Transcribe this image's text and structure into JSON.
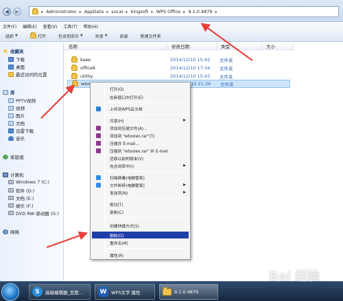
{
  "address": {
    "segments": [
      "Administrator",
      "AppData",
      "Local",
      "kingsoft",
      "WPS Office",
      "9.1.0.4879"
    ]
  },
  "menubar": [
    "文件(F)",
    "编辑(E)",
    "查看(V)",
    "工具(T)",
    "帮助(H)"
  ],
  "toolbar": {
    "organize": "组织",
    "open": "打开",
    "include": "包含到库中",
    "share": "共享",
    "burn": "刻录",
    "new_folder": "新建文件夹"
  },
  "nav": {
    "favorites_header": "收藏夹",
    "favorites": [
      "下载",
      "桌面",
      "最近访问的位置"
    ],
    "libraries_header": "库",
    "libraries": [
      "PPTV视频",
      "视频",
      "图片",
      "文档",
      "迅雷下载",
      "音乐"
    ],
    "homegroup": "家庭组",
    "computer_header": "计算机",
    "drives": [
      "Windows 7 (C:)",
      "软件 (D:)",
      "文档 (E:)",
      "娱乐 (F:)",
      "DVD RW 驱动器 (G:)"
    ],
    "network": "网络"
  },
  "columns": {
    "name": "名称",
    "modified": "修改日期",
    "type": "类型",
    "size": "大小"
  },
  "files": [
    {
      "name": "ksee",
      "date": "2014/12/10 15:42",
      "type": "文件夹"
    },
    {
      "name": "office6",
      "date": "2014/12/10 17:34",
      "type": "文件夹"
    },
    {
      "name": "utility",
      "date": "2014/12/10 15:43",
      "type": "文件夹"
    },
    {
      "name": "wtoolex",
      "date": "2014/12/10 21:36",
      "type": "文件夹"
    }
  ],
  "context_menu": {
    "open": "打开(O)",
    "open_new_window": "在新窗口中打开(E)",
    "upload_wps": "上传到WPS云文档",
    "share": "共享(H)",
    "add_archive": "添加到压缩文件(A)...",
    "add_rar": "添加到 \"wtoolex.rar\"(T)",
    "compress_email": "压缩并 E-mail...",
    "compress_rar_email": "压缩到 \"wtoolex.rar\" 并 E-mail",
    "restore_previous": "还原以前的版本(V)",
    "include_library": "包含到库中(I)",
    "scan_virus": "扫描病毒(电脑管家)",
    "shred_file": "文件粉碎(电脑管家)",
    "send_to": "发送到(N)",
    "cut": "剪切(T)",
    "copy": "复制(C)",
    "create_shortcut": "创建快捷方式(S)",
    "delete": "删除(D)",
    "rename": "重命名(M)",
    "properties": "属性(R)"
  },
  "taskbar": {
    "tasks": [
      "高级编辑器_百度...",
      "WPS文字 属性",
      "9.1.0.4879"
    ]
  },
  "watermark": "Bai 经验"
}
